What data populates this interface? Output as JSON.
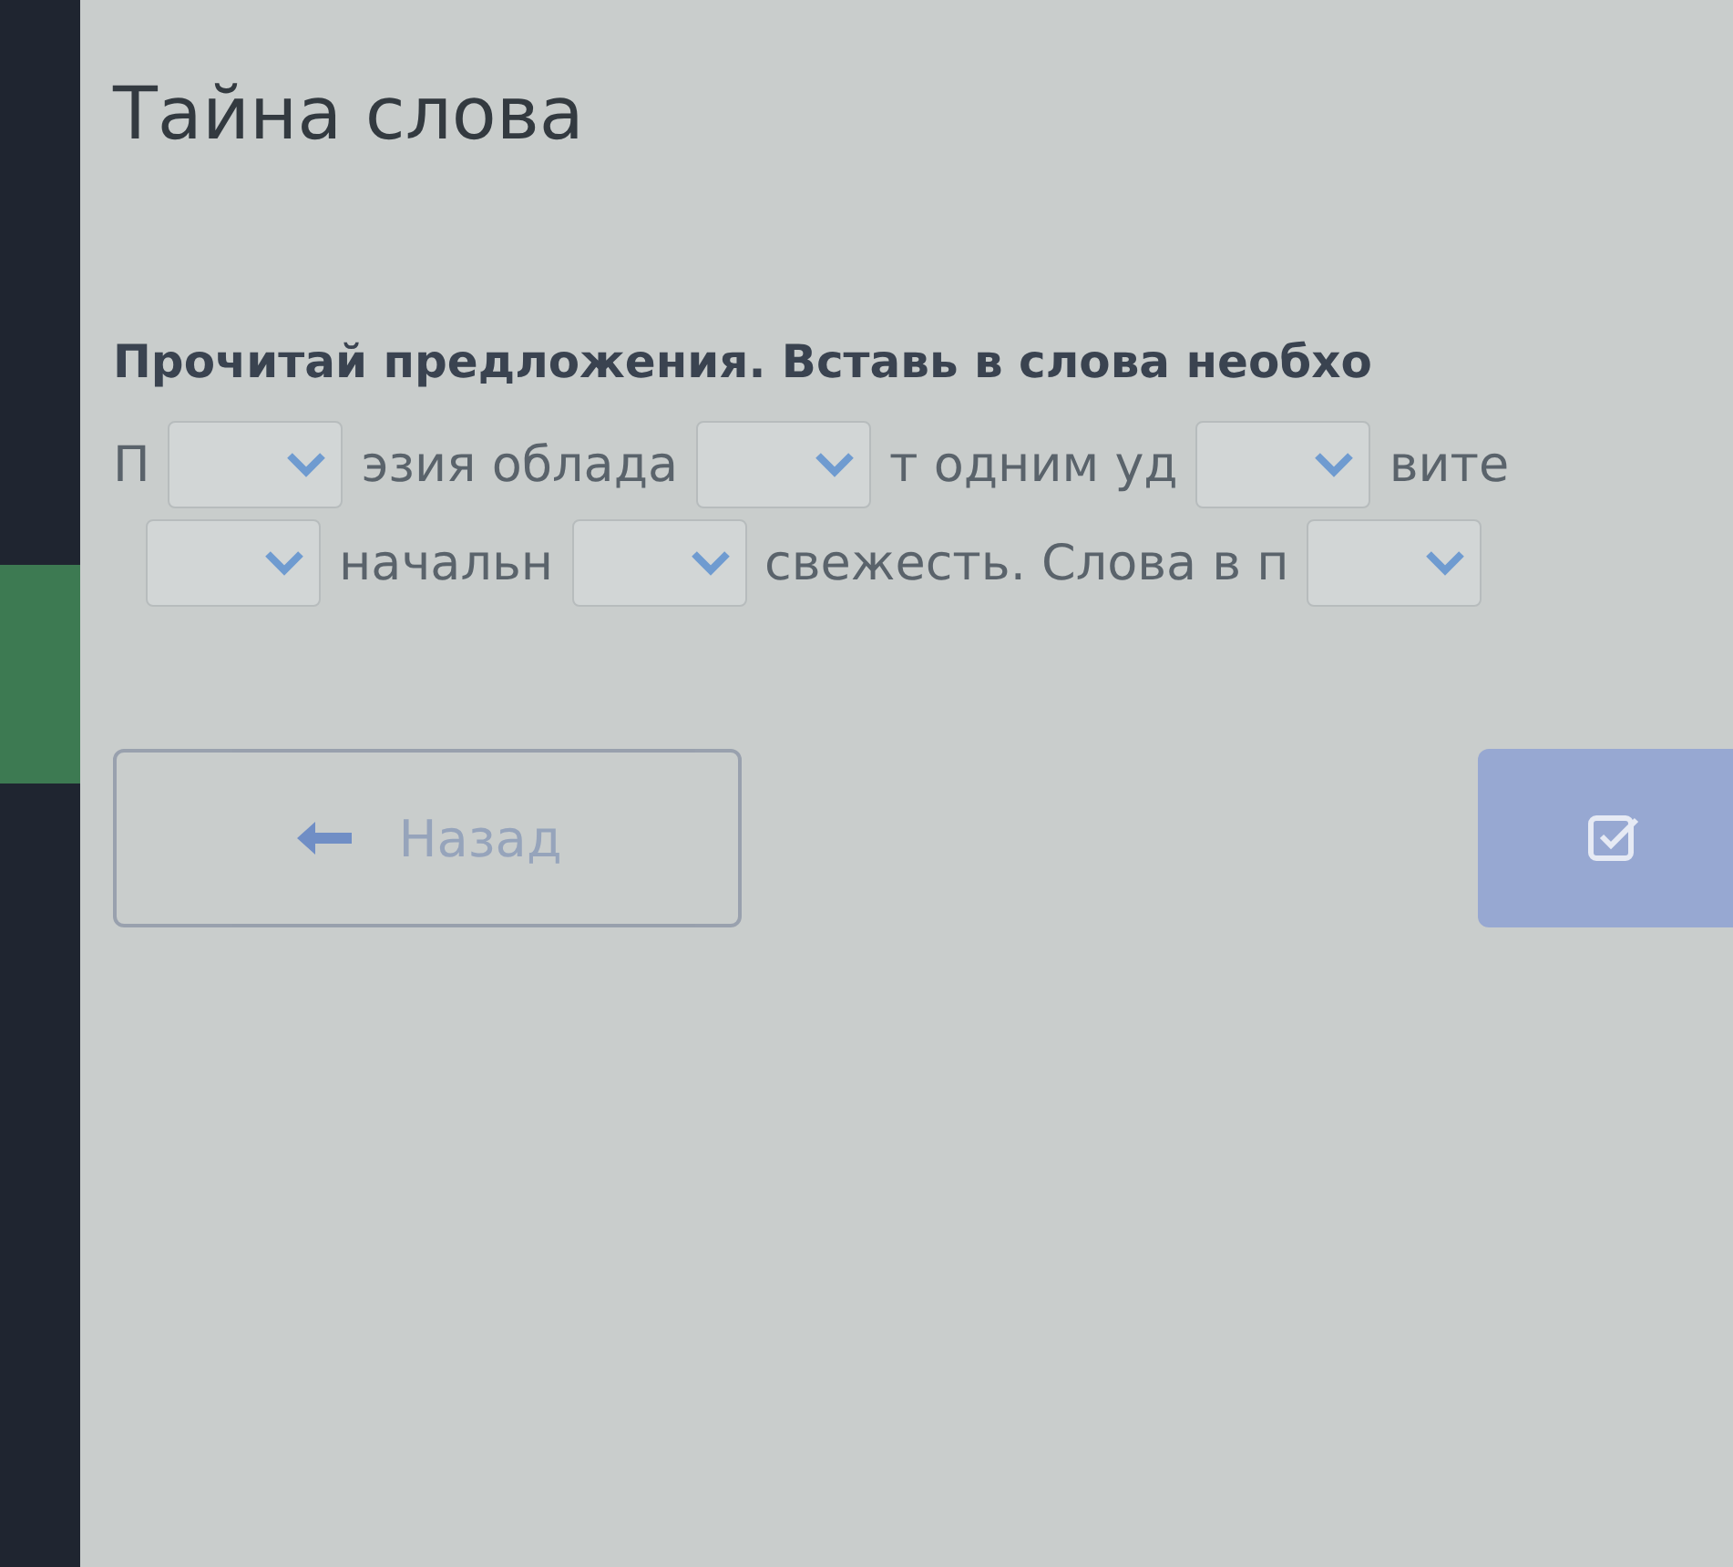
{
  "title": "Тайна слова",
  "instruction": "Прочитай предложения. Вставь в слова необхо",
  "lines": [
    [
      {
        "kind": "text",
        "text": "П"
      },
      {
        "kind": "select"
      },
      {
        "kind": "text",
        "text": "эзия облада"
      },
      {
        "kind": "select"
      },
      {
        "kind": "text",
        "text": "т одним уд"
      },
      {
        "kind": "select"
      },
      {
        "kind": "text",
        "text": "вите"
      }
    ],
    [
      {
        "kind": "select"
      },
      {
        "kind": "text",
        "text": "начальн"
      },
      {
        "kind": "select"
      },
      {
        "kind": "text",
        "text": "свежесть. Слова в п"
      },
      {
        "kind": "select"
      }
    ]
  ],
  "back_button": {
    "label": "Назад",
    "disabled": true
  },
  "check_button": {
    "disabled": true
  }
}
